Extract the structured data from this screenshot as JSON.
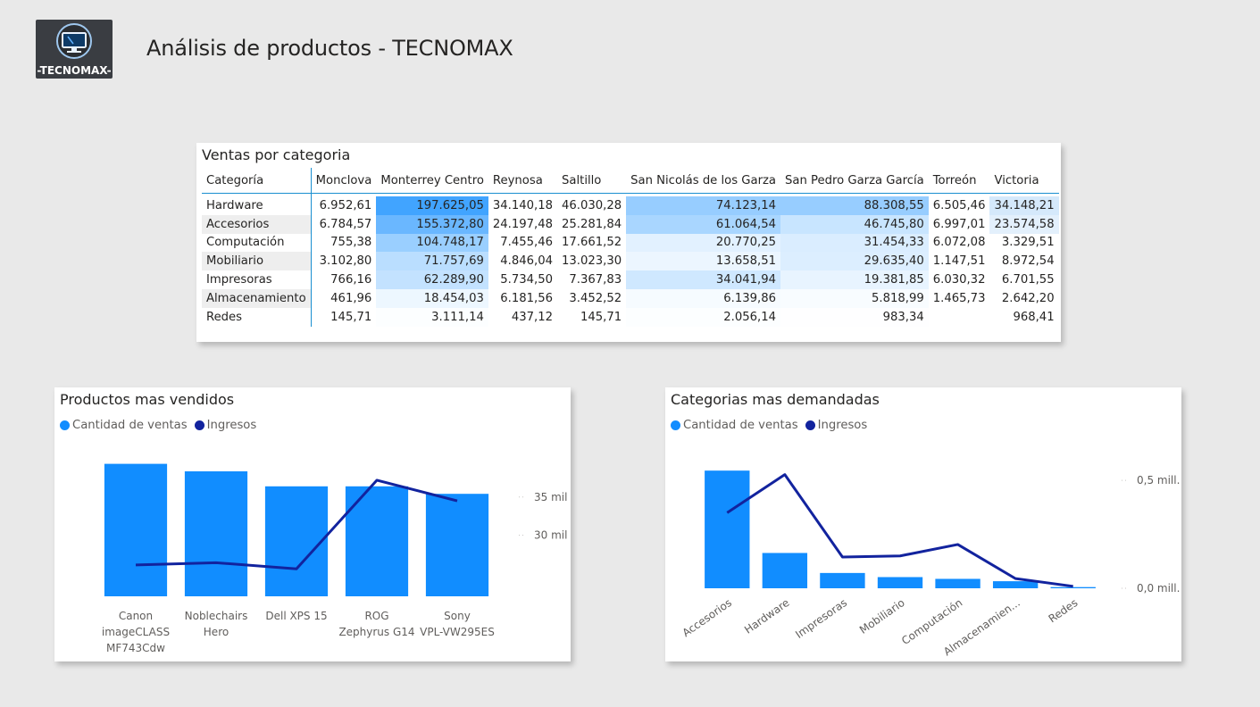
{
  "header": {
    "logo_text": "-TECNOMAX-",
    "title": "Análisis de productos - TECNOMAX"
  },
  "colors": {
    "bar": "#118dff",
    "line": "#12239e",
    "heat_max": "#41a4ff",
    "heat_min": "#ffffff",
    "grid_accent": "#1a8fd0"
  },
  "matrix": {
    "title": "Ventas por categoria",
    "corner_header": "Categoría",
    "columns": [
      "Monclova",
      "Monterrey Centro",
      "Reynosa",
      "Saltillo",
      "San Nicolás de los Garza",
      "San Pedro Garza García",
      "Torreón",
      "Victoria"
    ],
    "rows": [
      {
        "category": "Hardware",
        "cells": [
          "6.952,61",
          "197.625,05",
          "34.140,18",
          "46.030,28",
          "74.123,14",
          "88.308,55",
          "6.505,46",
          "34.148,21"
        ],
        "values": [
          6952.61,
          197625.05,
          34140.18,
          46030.28,
          74123.14,
          88308.55,
          6505.46,
          34148.21
        ]
      },
      {
        "category": "Accesorios",
        "cells": [
          "6.784,57",
          "155.372,80",
          "24.197,48",
          "25.281,84",
          "61.064,54",
          "46.745,80",
          "6.997,01",
          "23.574,58"
        ],
        "values": [
          6784.57,
          155372.8,
          24197.48,
          25281.84,
          61064.54,
          46745.8,
          6997.01,
          23574.58
        ]
      },
      {
        "category": "Computación",
        "cells": [
          "755,38",
          "104.748,17",
          "7.455,46",
          "17.661,52",
          "20.770,25",
          "31.454,33",
          "6.072,08",
          "3.329,51"
        ],
        "values": [
          755.38,
          104748.17,
          7455.46,
          17661.52,
          20770.25,
          31454.33,
          6072.08,
          3329.51
        ]
      },
      {
        "category": "Mobiliario",
        "cells": [
          "3.102,80",
          "71.757,69",
          "4.846,04",
          "13.023,30",
          "13.658,51",
          "29.635,40",
          "1.147,51",
          "8.972,54"
        ],
        "values": [
          3102.8,
          71757.69,
          4846.04,
          13023.3,
          13658.51,
          29635.4,
          1147.51,
          8972.54
        ]
      },
      {
        "category": "Impresoras",
        "cells": [
          "766,16",
          "62.289,90",
          "5.734,50",
          "7.367,83",
          "34.041,94",
          "19.381,85",
          "6.030,32",
          "6.701,55"
        ],
        "values": [
          766.16,
          62289.9,
          5734.5,
          7367.83,
          34041.94,
          19381.85,
          6030.32,
          6701.55
        ]
      },
      {
        "category": "Almacenamiento",
        "cells": [
          "461,96",
          "18.454,03",
          "6.181,56",
          "3.452,52",
          "6.139,86",
          "5.818,99",
          "1.465,73",
          "2.642,20"
        ],
        "values": [
          461.96,
          18454.03,
          6181.56,
          3452.52,
          6139.86,
          5818.99,
          1465.73,
          2642.2
        ]
      },
      {
        "category": "Redes",
        "cells": [
          "145,71",
          "3.111,14",
          "437,12",
          "145,71",
          "2.056,14",
          "983,34",
          "",
          "968,41"
        ],
        "values": [
          145.71,
          3111.14,
          437.12,
          145.71,
          2056.14,
          983.34,
          null,
          968.41
        ]
      }
    ]
  },
  "chart_data": [
    {
      "type": "bar",
      "title": "Productos mas vendidos",
      "legend": [
        "Cantidad de ventas",
        "Ingresos"
      ],
      "legend_position": "top-left",
      "categories": [
        [
          "Canon",
          "imageCLASS",
          "MF743Cdw"
        ],
        [
          "Noblechairs",
          "Hero"
        ],
        [
          "Dell XPS 15"
        ],
        [
          "ROG",
          "Zephyrus G14"
        ],
        [
          "Sony",
          "VPL-VW295ES"
        ]
      ],
      "series": [
        {
          "name": "Cantidad de ventas",
          "kind": "bar",
          "values": [
            53,
            50,
            44,
            44,
            41
          ],
          "ylim": [
            0,
            55
          ]
        },
        {
          "name": "Ingresos",
          "kind": "line",
          "axis": "right",
          "values": [
            26100,
            26400,
            25600,
            37200,
            34500
          ]
        }
      ],
      "right_axis": {
        "ticks": [
          {
            "value": 30000,
            "label": "30 mil"
          },
          {
            "value": 35000,
            "label": "35 mil"
          }
        ],
        "ylim": [
          22000,
          40000
        ]
      },
      "grid": false
    },
    {
      "type": "bar",
      "title": "Categorias mas demandadas",
      "legend": [
        "Cantidad de ventas",
        "Ingresos"
      ],
      "legend_position": "top-left",
      "categories": [
        "Accesorios",
        "Hardware",
        "Impresoras",
        "Mobiliario",
        "Computación",
        "Almacenamien...",
        "Redes"
      ],
      "series": [
        {
          "name": "Cantidad de ventas",
          "kind": "bar",
          "values": [
            1000,
            300,
            130,
            95,
            80,
            60,
            10
          ],
          "ylim": [
            0,
            1100
          ]
        },
        {
          "name": "Ingresos",
          "kind": "line",
          "axis": "right",
          "values": [
            350000,
            527000,
            145000,
            150000,
            203000,
            45000,
            9000
          ]
        }
      ],
      "right_axis": {
        "ticks": [
          {
            "value": 0,
            "label": "0,0 mill."
          },
          {
            "value": 500000,
            "label": "0,5 mill."
          }
        ],
        "ylim": [
          0,
          600000
        ]
      },
      "grid": false
    }
  ]
}
